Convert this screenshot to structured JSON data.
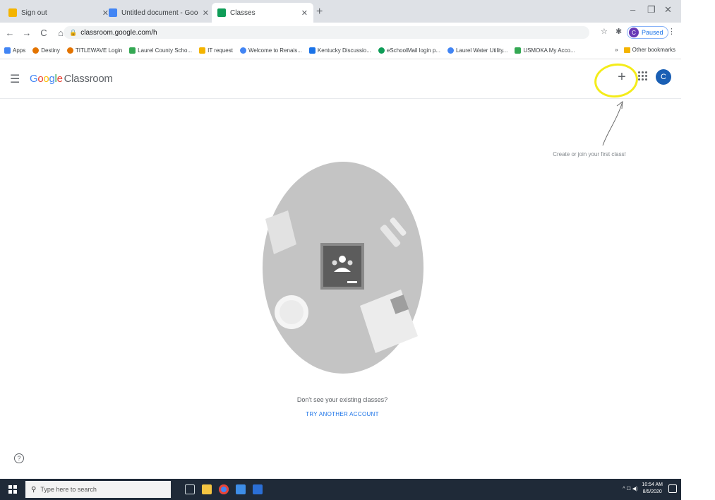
{
  "browser": {
    "tabs": [
      {
        "title": "Sign out",
        "favicon_color": "#f4b400",
        "active": false
      },
      {
        "title": "Untitled document - Google Do",
        "favicon_color": "#4285f4",
        "active": false
      },
      {
        "title": "Classes",
        "favicon_color": "#0f9d58",
        "active": true
      }
    ],
    "new_tab_symbol": "+",
    "window_controls": [
      "–",
      "❐",
      "✕"
    ],
    "nav": {
      "back": "←",
      "forward": "→",
      "reload": "C",
      "home": "⌂"
    },
    "url": "classroom.google.com/h",
    "profile_label": "Paused",
    "profile_initial": "C"
  },
  "bookmarks": {
    "items": [
      {
        "label": "Apps",
        "color": "#4285f4"
      },
      {
        "label": "Destiny",
        "color": "#e37400"
      },
      {
        "label": "TITLEWAVE Login",
        "color": "#e37400"
      },
      {
        "label": "Laurel County Scho...",
        "color": "#34a853"
      },
      {
        "label": "IT request",
        "color": "#f4b400"
      },
      {
        "label": "Welcome to Renais...",
        "color": "#4285f4"
      },
      {
        "label": "Kentucky Discussio...",
        "color": "#1a73e8"
      },
      {
        "label": "eSchoolMail login p...",
        "color": "#0f9d58"
      },
      {
        "label": "Laurel Water Utility...",
        "color": "#4285f4"
      },
      {
        "label": "USMOKA My Acco...",
        "color": "#34a853"
      }
    ],
    "overflow": "»",
    "other_bookmarks": "Other bookmarks"
  },
  "classroom": {
    "logo_letters": [
      "G",
      "o",
      "o",
      "g",
      "l",
      "e"
    ],
    "product_name": "Classroom",
    "plus_symbol": "+",
    "avatar_initial": "C",
    "hint": "Create or join your first class!",
    "empty_message": "Don't see your existing classes?",
    "try_another": "TRY ANOTHER ACCOUNT",
    "help_symbol": "?"
  },
  "taskbar": {
    "search_placeholder": "Type here to search",
    "time": "10:54 AM",
    "date": "8/5/2020",
    "tray_symbols": "^  ☐  ◀)"
  }
}
